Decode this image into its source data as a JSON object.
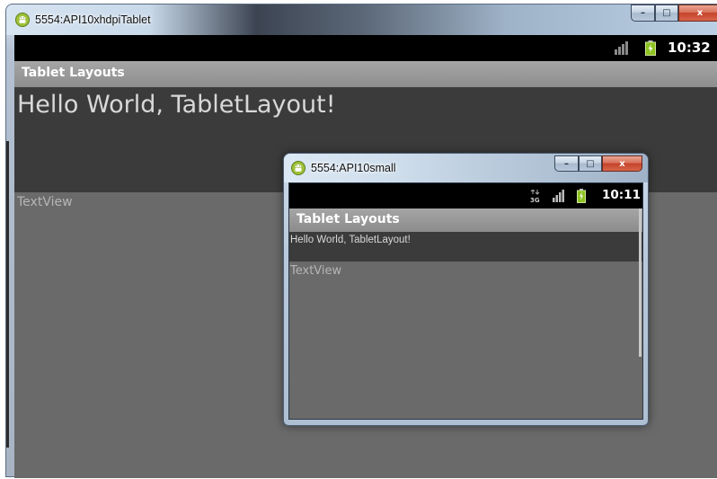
{
  "large_window": {
    "title": "5554:API10xhdpiTablet",
    "buttons": {
      "minimize": "–",
      "maximize": "□",
      "close": "x"
    },
    "status_time": "10:32",
    "app_title": "Tablet Layouts",
    "hello_text": "Hello World, TabletLayout!",
    "textview": "TextView"
  },
  "small_window": {
    "title": "5554:API10small",
    "buttons": {
      "minimize": "–",
      "maximize": "□",
      "close": "x"
    },
    "status_time": "10:11",
    "app_title": "Tablet Layouts",
    "hello_text": "Hello World, TabletLayout!",
    "textview": "TextView"
  },
  "icons": [
    "android-icon",
    "signal-icon",
    "battery-icon",
    "data-3g-icon"
  ],
  "colors": {
    "battery_green": "#8ec320",
    "close_red": "#c4432a",
    "screen_bg": "#6a6a6a",
    "hello_bg": "#3b3b3b"
  }
}
